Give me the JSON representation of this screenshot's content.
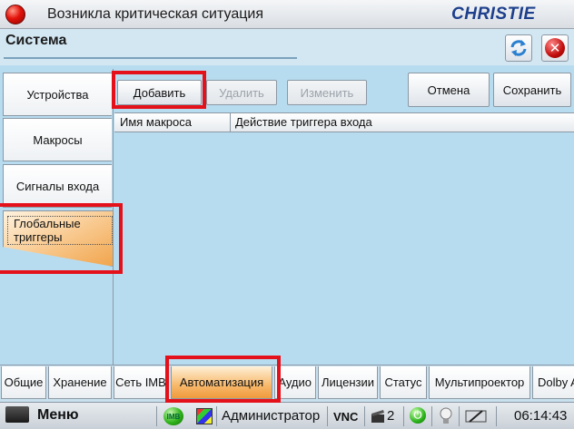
{
  "window": {
    "title": "Возникла критическая ситуация",
    "brand": "CHRISTIE"
  },
  "header": {
    "title": "Система"
  },
  "side_tabs": [
    {
      "label": "Устройства"
    },
    {
      "label": "Макросы"
    },
    {
      "label": "Сигналы входа"
    },
    {
      "label": "Глобальные триггеры",
      "selected": true
    }
  ],
  "toolbar": {
    "add": "Добавить",
    "delete": "Удалить",
    "edit": "Изменить",
    "cancel": "Отмена",
    "save": "Сохранить"
  },
  "table": {
    "columns": [
      "Имя макроса",
      "Действие триггера входа"
    ],
    "rows": []
  },
  "bottom_tabs": [
    {
      "label": "Общие"
    },
    {
      "label": "Хранение"
    },
    {
      "label": "Сеть IMB"
    },
    {
      "label": "Автоматизация",
      "selected": true
    },
    {
      "label": "Аудио"
    },
    {
      "label": "Лицензии"
    },
    {
      "label": "Статус"
    },
    {
      "label": "Мультипроектор"
    },
    {
      "label": "Dolby A"
    }
  ],
  "statusbar": {
    "menu": "Меню",
    "imb_badge": "IMB",
    "user": "Администратор",
    "vnc": "VNC",
    "count": "2",
    "time": "06:14:43"
  },
  "colors": {
    "highlight": "#e4101a",
    "selected_tab": "#f7b86b",
    "panel": "#b8dcef"
  },
  "icons": [
    "alarm-icon",
    "refresh-icon",
    "close-icon",
    "menu-icon",
    "imb-status-icon",
    "palette-icon",
    "clapper-icon",
    "power-icon",
    "bulb-icon",
    "lamp-icon"
  ]
}
